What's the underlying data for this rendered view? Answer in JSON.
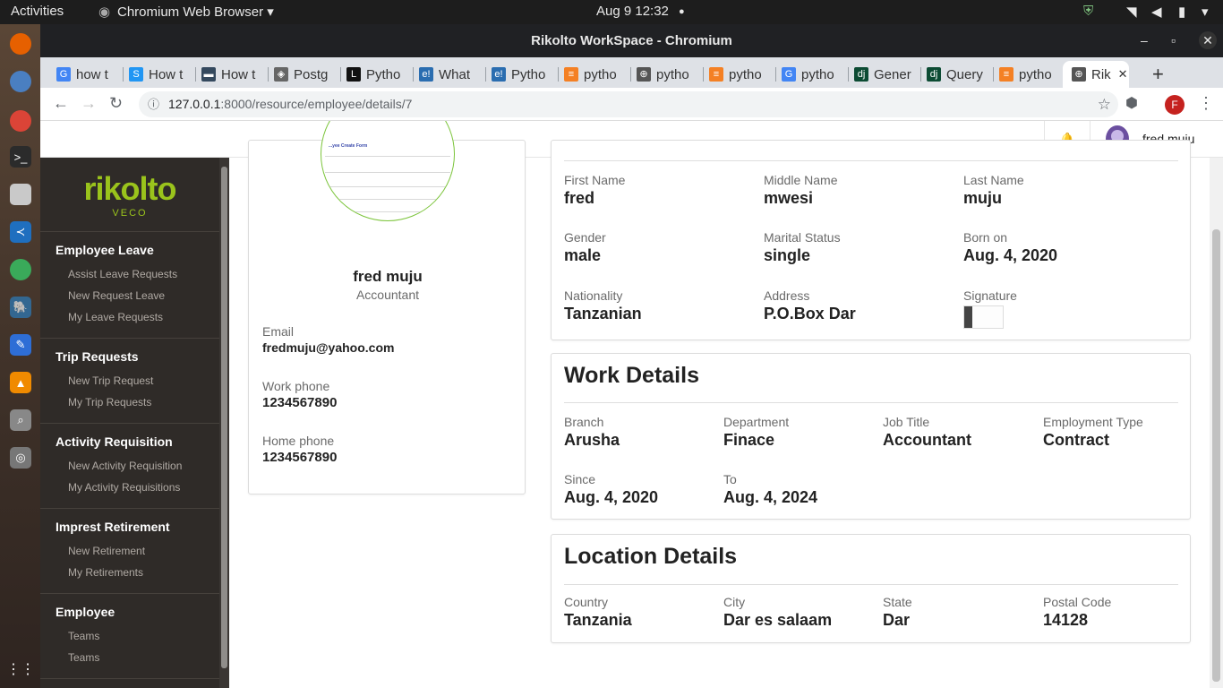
{
  "os": {
    "activities": "Activities",
    "app_menu": "Chromium Web Browser ▾",
    "datetime": "Aug 9  12:32",
    "dot": "●"
  },
  "window": {
    "title": "Rikolto WorkSpace - Chromium",
    "tabs": [
      {
        "label": "how t",
        "icon": "google-icon",
        "color": "#4285f4",
        "glyph": "G"
      },
      {
        "label": "How t",
        "icon": "s-icon",
        "color": "#2196f3",
        "glyph": "S"
      },
      {
        "label": "How t",
        "icon": "page-icon",
        "color": "#34495e",
        "glyph": "▬"
      },
      {
        "label": "Postg",
        "icon": "diamond-icon",
        "color": "#666666",
        "glyph": "◈"
      },
      {
        "label": "Pytho",
        "icon": "l-icon",
        "color": "#111111",
        "glyph": "L"
      },
      {
        "label": "What",
        "icon": "e-icon",
        "color": "#2a6db0",
        "glyph": "e!"
      },
      {
        "label": "Pytho",
        "icon": "e-icon",
        "color": "#2a6db0",
        "glyph": "e!"
      },
      {
        "label": "pytho",
        "icon": "stackoverflow-icon",
        "color": "#f48024",
        "glyph": "≡"
      },
      {
        "label": "pytho",
        "icon": "globe-icon",
        "color": "#555555",
        "glyph": "⊕"
      },
      {
        "label": "pytho",
        "icon": "stackoverflow-icon",
        "color": "#f48024",
        "glyph": "≡"
      },
      {
        "label": "pytho",
        "icon": "google-icon",
        "color": "#4285f4",
        "glyph": "G"
      },
      {
        "label": "Gener",
        "icon": "django-icon",
        "color": "#0c4b33",
        "glyph": "dj"
      },
      {
        "label": "Query",
        "icon": "django-icon",
        "color": "#0c4b33",
        "glyph": "dj"
      },
      {
        "label": "pytho",
        "icon": "stackoverflow-icon",
        "color": "#f48024",
        "glyph": "≡"
      },
      {
        "label": "Rik",
        "icon": "globe-icon",
        "color": "#555555",
        "glyph": "⊕"
      }
    ],
    "url_host": "127.0.0.1",
    "url_path": ":8000/resource/employee/details/7",
    "profile_initial": "F"
  },
  "header": {
    "user_name": "fred muju"
  },
  "sidebar": {
    "logo_main": "rikolto",
    "logo_sub": "VECO",
    "sections": [
      {
        "title": "Employee Leave",
        "items": [
          "Assist Leave Requests",
          "New Request Leave",
          "My Leave Requests"
        ]
      },
      {
        "title": "Trip Requests",
        "items": [
          "New Trip Request",
          "My Trip Requests"
        ]
      },
      {
        "title": "Activity Requisition",
        "items": [
          "New Activity Requisition",
          "My Activity Requisitions"
        ]
      },
      {
        "title": "Imprest Retirement",
        "items": [
          "New Retirement",
          "My Retirements"
        ]
      },
      {
        "title": "Employee",
        "items": [
          "Teams",
          "Teams"
        ]
      }
    ]
  },
  "profile": {
    "name": "fred muju",
    "role": "Accountant",
    "image_caption": "...yee Create Form",
    "email_label": "Email",
    "email": "fredmuju@yahoo.com",
    "work_phone_label": "Work phone",
    "work_phone": "1234567890",
    "home_phone_label": "Home phone",
    "home_phone": "1234567890"
  },
  "personal": {
    "first_name_label": "First Name",
    "first_name": "fred",
    "middle_name_label": "Middle Name",
    "middle_name": "mwesi",
    "last_name_label": "Last Name",
    "last_name": "muju",
    "gender_label": "Gender",
    "gender": "male",
    "marital_label": "Marital Status",
    "marital": "single",
    "born_label": "Born on",
    "born": "Aug. 4, 2020",
    "nationality_label": "Nationality",
    "nationality": "Tanzanian",
    "address_label": "Address",
    "address": "P.O.Box Dar",
    "signature_label": "Signature"
  },
  "work": {
    "title": "Work Details",
    "branch_label": "Branch",
    "branch": "Arusha",
    "department_label": "Department",
    "department": "Finace",
    "job_title_label": "Job Title",
    "job_title": "Accountant",
    "employment_type_label": "Employment Type",
    "employment_type": "Contract",
    "since_label": "Since",
    "since": "Aug. 4, 2020",
    "to_label": "To",
    "to": "Aug. 4, 2024"
  },
  "location": {
    "title": "Location Details",
    "country_label": "Country",
    "country": "Tanzania",
    "city_label": "City",
    "city": "Dar es salaam",
    "state_label": "State",
    "state": "Dar",
    "postal_label": "Postal Code",
    "postal": "14128"
  }
}
